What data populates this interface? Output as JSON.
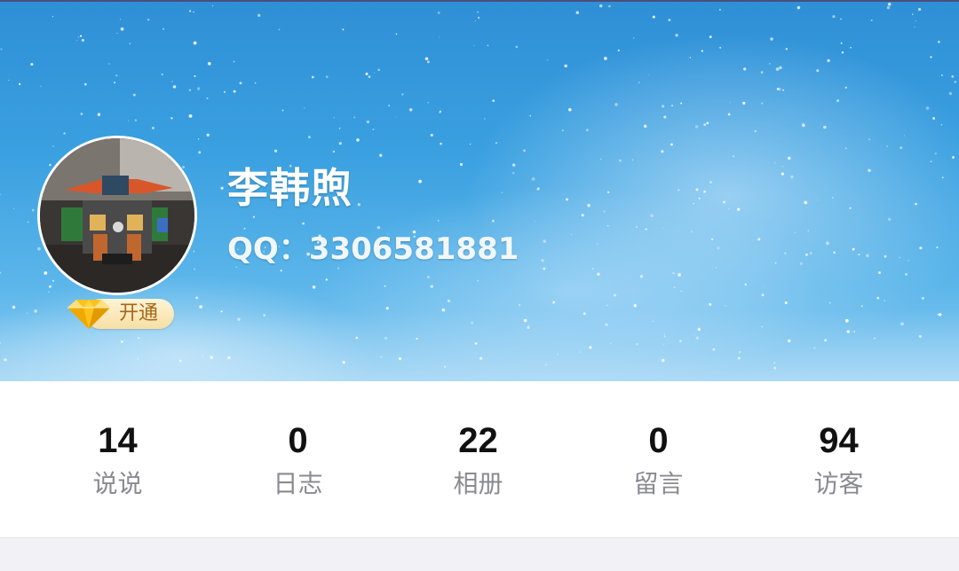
{
  "profile": {
    "name": "李韩煦",
    "qq": "QQ：3306581881",
    "vip_label": "开通"
  },
  "stats": [
    {
      "count": "14",
      "label": "说说"
    },
    {
      "count": "0",
      "label": "日志"
    },
    {
      "count": "22",
      "label": "相册"
    },
    {
      "count": "0",
      "label": "留言"
    },
    {
      "count": "94",
      "label": "访客"
    }
  ],
  "icons": {
    "vip": "diamond-icon"
  },
  "colors": {
    "cover_sky": "#3aa0e0",
    "vip_text": "#a5671a",
    "stat_count": "#111111",
    "stat_label": "#8a8a92"
  }
}
